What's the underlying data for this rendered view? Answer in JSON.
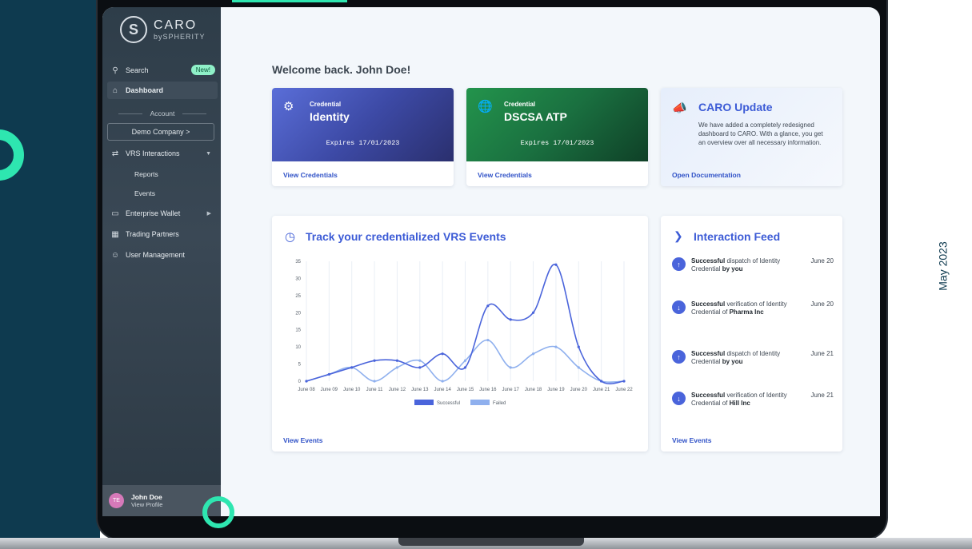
{
  "side_caption": "May 2023",
  "brand": {
    "name": "CARO",
    "sub": "bySPHERITY"
  },
  "sidebar": {
    "search_label": "Search",
    "new_badge": "New!",
    "dashboard_label": "Dashboard",
    "account_section": "Account",
    "company_button": "Demo Company  >",
    "vrs_label": "VRS Interactions",
    "vrs_sub": [
      "Reports",
      "Events"
    ],
    "wallet_label": "Enterprise Wallet",
    "partners_label": "Trading Partners",
    "users_label": "User Management"
  },
  "profile": {
    "initials": "TE",
    "name": "John Doe",
    "link": "View Profile"
  },
  "welcome": "Welcome back. John Doe!",
  "cards": {
    "identity": {
      "label": "Credential",
      "title": "Identity",
      "expires": "Expires 17/01/2023",
      "link": "View Credentials"
    },
    "dscsa": {
      "label": "Credential",
      "title": "DSCSA ATP",
      "expires": "Expires 17/01/2023",
      "link": "View Credentials"
    },
    "update": {
      "title": "CARO Update",
      "body": "We have added a completely redesigned dashboard to CARO. With a glance, you get an overview over all necessary information.",
      "link": "Open Documentation"
    }
  },
  "events_panel": {
    "title": "Track your credentialized VRS Events",
    "link": "View Events"
  },
  "feed": {
    "title": "Interaction Feed",
    "link": "View Events",
    "items": [
      {
        "status": "Successful",
        "action": " dispatch of Identity Credential ",
        "who_prefix": "",
        "who": "by you",
        "date": "June 20",
        "direction": "up"
      },
      {
        "status": "Successful",
        "action": " verification of Identity Credential of ",
        "who_prefix": "",
        "who": "Pharma Inc",
        "date": "June 20",
        "direction": "down"
      },
      {
        "status": "Successful",
        "action": " dispatch of Identity Credential ",
        "who_prefix": "",
        "who": "by you",
        "date": "June 21",
        "direction": "up"
      },
      {
        "status": "Successful",
        "action": " verification of Identity Credential of ",
        "who_prefix": "",
        "who": "Hill Inc",
        "date": "June 21",
        "direction": "down"
      }
    ]
  },
  "colors": {
    "accent": "#3c5bd6",
    "successful": "#4a64db",
    "failed": "#8fb0ee",
    "brand_green": "#2ee6b0"
  },
  "chart_data": {
    "type": "line",
    "categories": [
      "June 08",
      "June 09",
      "June 10",
      "June 11",
      "June 12",
      "June 13",
      "June 14",
      "June 15",
      "June 16",
      "June 17",
      "June 18",
      "June 19",
      "June 20",
      "June 21",
      "June 22"
    ],
    "series": [
      {
        "name": "Successful",
        "values": [
          0,
          2,
          4,
          6,
          6,
          4,
          8,
          4,
          22,
          18,
          20,
          34,
          10,
          0,
          0
        ]
      },
      {
        "name": "Failed",
        "values": [
          0,
          2,
          4,
          0,
          4,
          6,
          0,
          6,
          12,
          4,
          8,
          10,
          4,
          0,
          0
        ]
      }
    ],
    "yticks": [
      0,
      5,
      10,
      15,
      20,
      25,
      30,
      35
    ],
    "ylim": [
      0,
      35
    ],
    "grid": true,
    "legend_position": "bottom"
  }
}
